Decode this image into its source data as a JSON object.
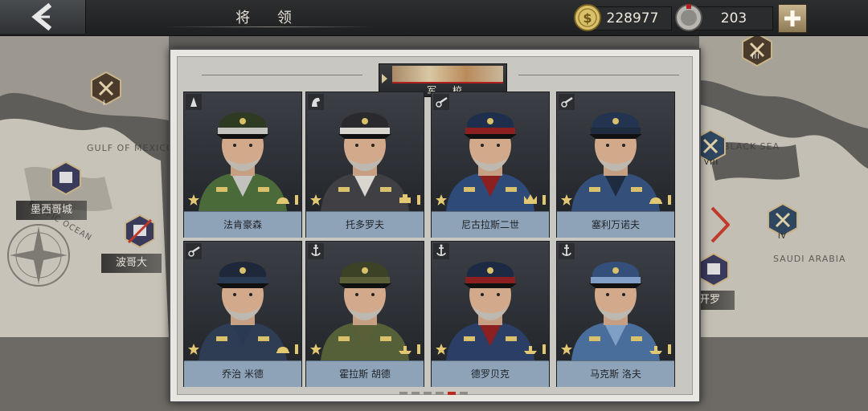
{
  "header": {
    "title": "将 领",
    "gold": "228977",
    "medals": "203"
  },
  "map": {
    "labels": [
      "GULF OF MEXICO",
      "BLACK SEA",
      "SAUDI ARABIA",
      "PACIFIC OCEAN"
    ],
    "cities": [
      "墨西哥城",
      "波哥大",
      "开罗"
    ],
    "badges": [
      "I",
      "VIII",
      "IV",
      "III"
    ]
  },
  "panel": {
    "tab_label": "军 校",
    "commanders": [
      {
        "name": "法肯豪森",
        "type": "infantry-icon",
        "branch": "infantry-helmet-icon"
      },
      {
        "name": "托多罗夫",
        "type": "cavalry-icon",
        "branch": "armor-icon"
      },
      {
        "name": "尼古拉斯二世",
        "type": "artillery-icon",
        "branch": "crown-icon"
      },
      {
        "name": "塞利万诺夫",
        "type": "artillery-icon",
        "branch": "infantry-helmet-icon"
      },
      {
        "name": "乔治 米德",
        "type": "artillery-icon",
        "branch": "infantry-helmet-icon"
      },
      {
        "name": "霍拉斯 胡德",
        "type": "anchor-icon",
        "branch": "ship-icon"
      },
      {
        "name": "德罗贝克",
        "type": "anchor-icon",
        "branch": "ship-icon"
      },
      {
        "name": "马克斯 洛夫",
        "type": "anchor-icon",
        "branch": "ship-icon"
      }
    ],
    "page_count": 6,
    "active_page": 5
  },
  "colors": {
    "name_bar": "#8ea2b8",
    "panel_bg": "#c9c7c2",
    "accent_red": "#b21f1f"
  }
}
